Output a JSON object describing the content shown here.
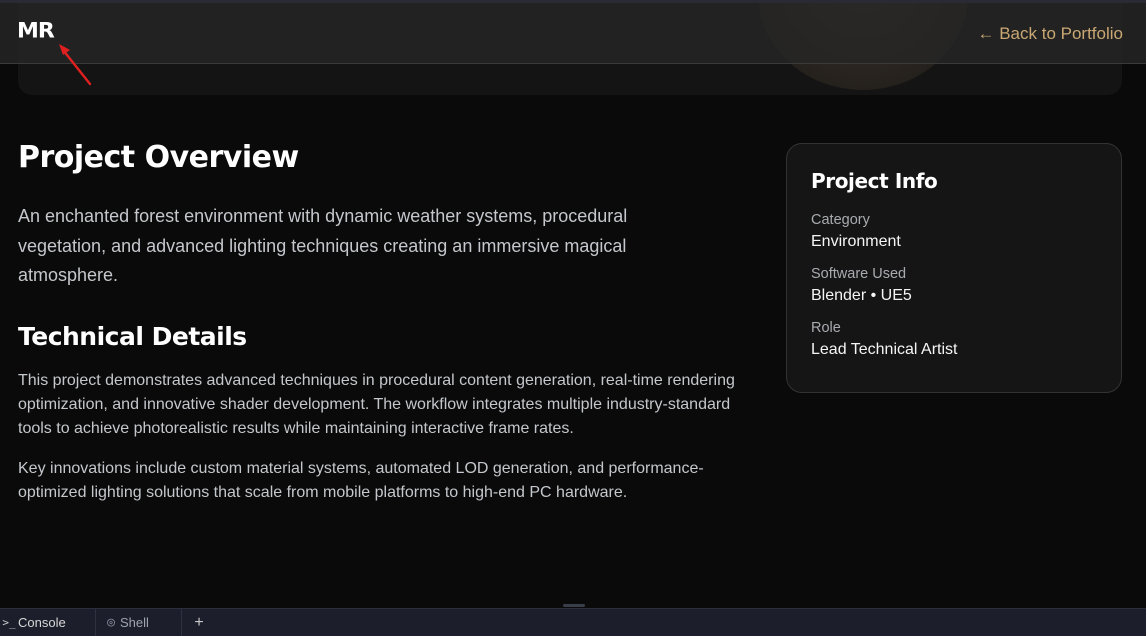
{
  "nav": {
    "logo": "MR",
    "back_link": "← Back to Portfolio"
  },
  "main": {
    "title": "Project Overview",
    "lead": "An enchanted forest environment with dynamic weather systems, procedural vegetation, and advanced lighting techniques creating an immersive magical atmosphere.",
    "technical_heading": "Technical Details",
    "paragraphs": [
      "This project demonstrates advanced techniques in procedural content generation, real-time rendering optimization, and innovative shader development. The workflow integrates multiple industry-standard tools to achieve photorealistic results while maintaining interactive frame rates.",
      "Key innovations include custom material systems, automated LOD generation, and performance-optimized lighting solutions that scale from mobile platforms to high-end PC hardware."
    ]
  },
  "info": {
    "title": "Project Info",
    "fields": [
      {
        "label": "Category",
        "value": "Environment"
      },
      {
        "label": "Software Used",
        "value": "Blender • UE5"
      },
      {
        "label": "Role",
        "value": "Lead Technical Artist"
      }
    ]
  },
  "console_bar": {
    "tabs": [
      {
        "label": "Console",
        "icon": "terminal-prompt-icon"
      },
      {
        "label": "Shell",
        "icon": "shell-icon"
      }
    ],
    "add_label": "+"
  },
  "colors": {
    "background": "#0a0a0a",
    "accent": "#c9a873",
    "annotation": "#e02020"
  }
}
